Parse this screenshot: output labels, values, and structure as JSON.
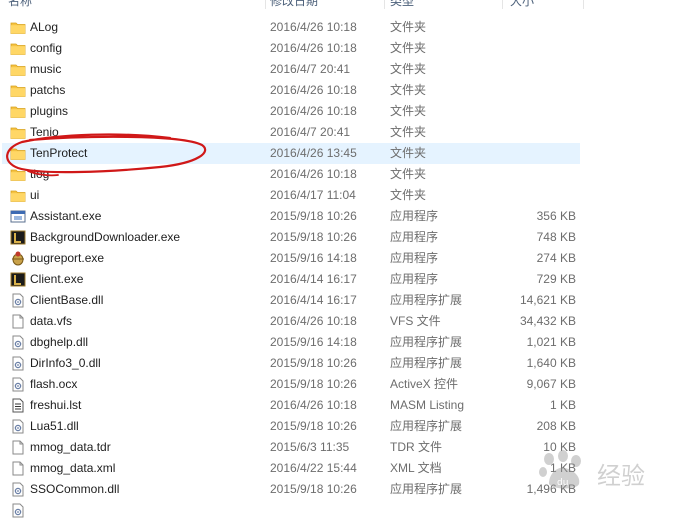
{
  "columns": {
    "name": "名称",
    "date": "修改日期",
    "type": "类型",
    "size": "大小"
  },
  "files": [
    {
      "name": "ALog",
      "date": "2016/4/26 10:18",
      "type": "文件夹",
      "size": "",
      "icon": "folder-icon"
    },
    {
      "name": "config",
      "date": "2016/4/26 10:18",
      "type": "文件夹",
      "size": "",
      "icon": "folder-icon"
    },
    {
      "name": "music",
      "date": "2016/4/7 20:41",
      "type": "文件夹",
      "size": "",
      "icon": "folder-icon"
    },
    {
      "name": "patchs",
      "date": "2016/4/26 10:18",
      "type": "文件夹",
      "size": "",
      "icon": "folder-icon"
    },
    {
      "name": "plugins",
      "date": "2016/4/26 10:18",
      "type": "文件夹",
      "size": "",
      "icon": "folder-icon"
    },
    {
      "name": "Tenio",
      "date": "2016/4/7 20:41",
      "type": "文件夹",
      "size": "",
      "icon": "folder-icon"
    },
    {
      "name": "TenProtect",
      "date": "2016/4/26 13:45",
      "type": "文件夹",
      "size": "",
      "icon": "folder-icon",
      "selected": true
    },
    {
      "name": "tlog",
      "date": "2016/4/26 10:18",
      "type": "文件夹",
      "size": "",
      "icon": "folder-icon"
    },
    {
      "name": "ui",
      "date": "2016/4/17 11:04",
      "type": "文件夹",
      "size": "",
      "icon": "folder-icon"
    },
    {
      "name": "Assistant.exe",
      "date": "2015/9/18 10:26",
      "type": "应用程序",
      "size": "356 KB",
      "icon": "assistant-app-icon"
    },
    {
      "name": "BackgroundDownloader.exe",
      "date": "2015/9/18 10:26",
      "type": "应用程序",
      "size": "748 KB",
      "icon": "league-app-icon"
    },
    {
      "name": "bugreport.exe",
      "date": "2015/9/16 14:18",
      "type": "应用程序",
      "size": "274 KB",
      "icon": "bug-icon"
    },
    {
      "name": "Client.exe",
      "date": "2016/4/14 16:17",
      "type": "应用程序",
      "size": "729 KB",
      "icon": "league-app-icon"
    },
    {
      "name": "ClientBase.dll",
      "date": "2016/4/14 16:17",
      "type": "应用程序扩展",
      "size": "14,621 KB",
      "icon": "dll-icon"
    },
    {
      "name": "data.vfs",
      "date": "2016/4/26 10:18",
      "type": "VFS 文件",
      "size": "34,432 KB",
      "icon": "blank-file-icon"
    },
    {
      "name": "dbghelp.dll",
      "date": "2015/9/16 14:18",
      "type": "应用程序扩展",
      "size": "1,021 KB",
      "icon": "dll-icon"
    },
    {
      "name": "DirInfo3_0.dll",
      "date": "2015/9/18 10:26",
      "type": "应用程序扩展",
      "size": "1,640 KB",
      "icon": "dll-icon"
    },
    {
      "name": "flash.ocx",
      "date": "2015/9/18 10:26",
      "type": "ActiveX 控件",
      "size": "9,067 KB",
      "icon": "dll-icon"
    },
    {
      "name": "freshui.lst",
      "date": "2016/4/26 10:18",
      "type": "MASM Listing",
      "size": "1 KB",
      "icon": "text-file-icon"
    },
    {
      "name": "Lua51.dll",
      "date": "2015/9/18 10:26",
      "type": "应用程序扩展",
      "size": "208 KB",
      "icon": "dll-icon"
    },
    {
      "name": "mmog_data.tdr",
      "date": "2015/6/3 11:35",
      "type": "TDR 文件",
      "size": "10 KB",
      "icon": "blank-file-icon"
    },
    {
      "name": "mmog_data.xml",
      "date": "2016/4/22 15:44",
      "type": "XML 文档",
      "size": "1 KB",
      "icon": "blank-file-icon"
    },
    {
      "name": "SSOCommon.dll",
      "date": "2015/9/18 10:26",
      "type": "应用程序扩展",
      "size": "1,496 KB",
      "icon": "dll-icon"
    },
    {
      "name": "",
      "date": "",
      "type": "",
      "size": "",
      "icon": "dll-icon"
    }
  ],
  "watermark": {
    "text": "经验"
  },
  "colors": {
    "selection": "#e5f3ff",
    "folder": "#f5c242",
    "annotation": "#d01818"
  }
}
